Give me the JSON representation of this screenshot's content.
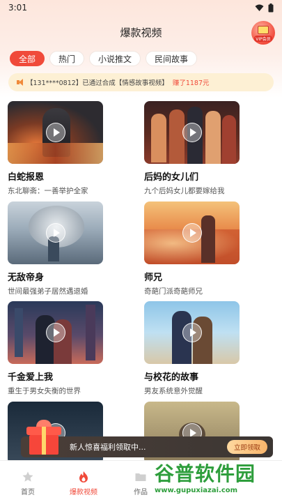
{
  "status": {
    "time": "3:01"
  },
  "header": {
    "title": "爆款视频",
    "vip_label": "VIP会员"
  },
  "tabs": [
    {
      "label": "全部",
      "active": true
    },
    {
      "label": "热门"
    },
    {
      "label": "小说推文"
    },
    {
      "label": "民间故事"
    }
  ],
  "notice": {
    "text": "【131****0812】已通过合成【情感故事视频】",
    "earn": "赚了1187元"
  },
  "cards": [
    {
      "title": "白蛇报恩",
      "subtitle": "东北聊斋：一善举护全家"
    },
    {
      "title": "后妈的女儿们",
      "subtitle": "九个后妈女儿都要嫁给我"
    },
    {
      "title": "无敌帝身",
      "subtitle": "世间最强弟子居然遇退婚"
    },
    {
      "title": "师兄",
      "subtitle": "奇葩门派奇葩师兄"
    },
    {
      "title": "千金爱上我",
      "subtitle": "重生于男女失衡的世界"
    },
    {
      "title": "与校花的故事",
      "subtitle": "男友系统意外觉醒"
    },
    {
      "title": "",
      "subtitle": ""
    },
    {
      "title": "",
      "subtitle": ""
    }
  ],
  "banner": {
    "text": "新人惊喜福利领取中...",
    "button": "立即领取"
  },
  "nav": [
    {
      "label": "首页",
      "icon": "home-icon"
    },
    {
      "label": "爆款视频",
      "icon": "fire-icon",
      "active": true
    },
    {
      "label": "作品",
      "icon": "folder-icon"
    }
  ],
  "watermark": {
    "main": "谷普软件园",
    "url": "www.gupuxiazai.com"
  }
}
